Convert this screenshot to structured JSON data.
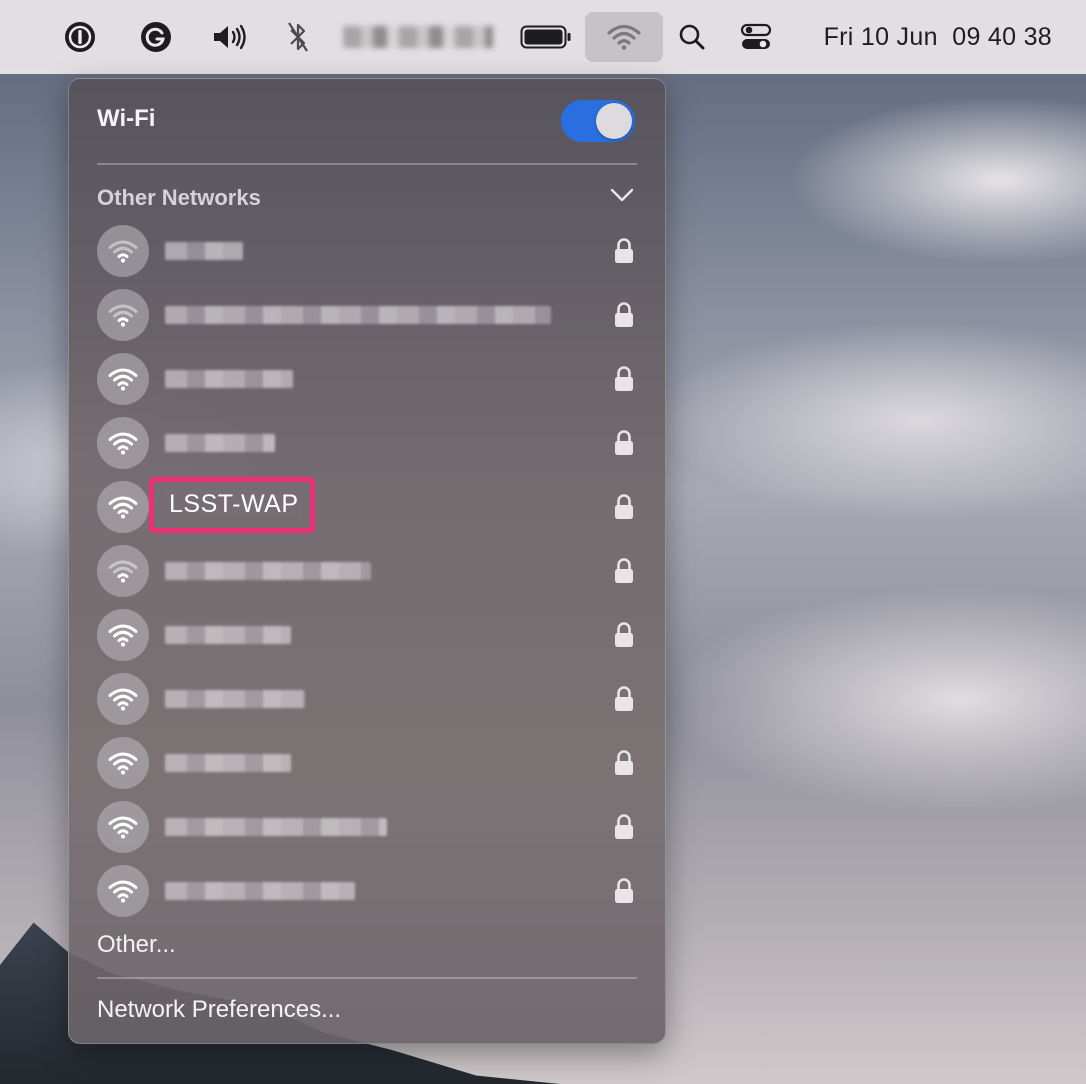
{
  "menubar": {
    "icons": [
      "onepassword-icon",
      "grammarly-icon",
      "volume-icon",
      "bluetooth-icon",
      "user-name-redacted",
      "battery-icon",
      "wifi-icon",
      "search-icon",
      "control-center-icon"
    ],
    "clock": {
      "day": "Fri",
      "date": "10 Jun",
      "time": "09 40 38"
    }
  },
  "wifi_panel": {
    "title": "Wi-Fi",
    "enabled": true,
    "accent": "#2a6fe0",
    "section_title": "Other Networks",
    "networks": [
      {
        "name": "",
        "redacted": true,
        "signal": "weak",
        "locked": true
      },
      {
        "name": "",
        "redacted": true,
        "signal": "weak",
        "locked": true
      },
      {
        "name": "",
        "redacted": true,
        "signal": "strong",
        "locked": true
      },
      {
        "name": "",
        "redacted": true,
        "signal": "strong",
        "locked": true
      },
      {
        "name": "LSST-WAP",
        "redacted": false,
        "signal": "strong",
        "locked": true,
        "highlighted": true
      },
      {
        "name": "",
        "redacted": true,
        "signal": "weak",
        "locked": true
      },
      {
        "name": "",
        "redacted": true,
        "signal": "strong",
        "locked": true
      },
      {
        "name": "",
        "redacted": true,
        "signal": "strong",
        "locked": true
      },
      {
        "name": "",
        "redacted": true,
        "signal": "strong",
        "locked": true
      },
      {
        "name": "",
        "redacted": true,
        "signal": "strong",
        "locked": true
      },
      {
        "name": "",
        "redacted": true,
        "signal": "strong",
        "locked": true
      }
    ],
    "other_label": "Other...",
    "preferences_label": "Network Preferences...",
    "highlight_color": "#ee2f76"
  }
}
